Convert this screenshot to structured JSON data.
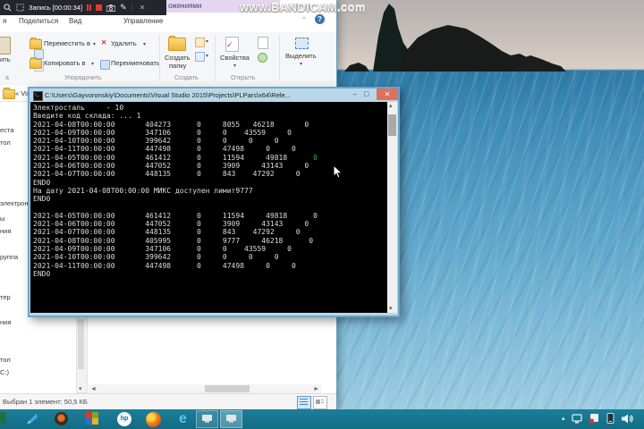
{
  "colors": {
    "taskbar_teal": "#15748e",
    "console_green_zero": "#3fae49",
    "console_close_button": "#e0705a",
    "contextual_tab_lavender": "#e4d5f0",
    "help_icon_blue": "#3674b5",
    "bandicam_red": "#e23b32"
  },
  "icons": {
    "dropdown": "▾",
    "close": "✕",
    "pencil": "✎",
    "scissors": "✂",
    "help": "?",
    "collapse": "⌃",
    "up": "▴",
    "down": "▾",
    "left": "◄",
    "right": "►",
    "tray_caret": "▴",
    "back": "«"
  },
  "bandicam_bar": {
    "record_label": "Запись [00:00:34]"
  },
  "watermark": {
    "text": "www.BANDICAM.com"
  },
  "explorer": {
    "contextual_header_fragment": "ожениями",
    "tabs": [
      {
        "label": "я"
      },
      {
        "label": "Поделиться"
      },
      {
        "label": "Вид"
      },
      {
        "label": "Управление"
      }
    ],
    "ribbon": {
      "paste_fragment": "ить",
      "clipboard_group_fragment": "а",
      "move_to": "Переместить в",
      "copy_to": "Копировать в",
      "delete": "Удалить",
      "rename": "Переименовать",
      "new_folder_line1": "Создать",
      "new_folder_line2": "папку",
      "properties": "Свойства",
      "select": "Выделить",
      "group_organize": "Упорядочить",
      "group_create": "Создать",
      "group_open": "Открыть"
    },
    "address_fragment": "« Vis",
    "nav_fragments": [
      {
        "text": "еста"
      },
      {
        "text": "тол"
      },
      {
        "text": "электрон"
      },
      {
        "text": "ы"
      },
      {
        "text": "ния"
      },
      {
        "text": "руппа"
      },
      {
        "text": "тер"
      },
      {
        "text": "ния"
      },
      {
        "text": "тол"
      },
      {
        "text": "C:)"
      }
    ],
    "status_text": "Выбран 1 элемент: 50,5 КБ"
  },
  "console": {
    "title": "C:\\Users\\Gayvoronskiy\\Documents\\Visual Studio 2015\\Projects\\PLPars\\x64\\Rele...",
    "green_line_index": 6,
    "lines": [
      "Электросталь     - 10",
      "Введите код склада: ... 1",
      "2021-04-08T00:00:00       404273      0     8055   46218       0",
      "2021-04-09T00:00:00       347106      0     0    43559     0",
      "2021-04-10T00:00:00       399642      0     0     0     0",
      "2021-04-11T00:00:00       447498      0     47498     0     0",
      "2021-04-05T00:00:00       461412      0     11594     49818      0",
      "2021-04-06T00:00:00       447052      0     3909     43143     0",
      "2021-04-07T00:00:00       448135      0     843    47292     0",
      "END0",
      "На дату 2021-04-08T00:00:00 МИКС доступен лимит9777",
      "END0",
      "",
      "2021-04-05T00:00:00       461412      0     11594     49818      0",
      "2021-04-06T00:00:00       447052      0     3909     43143     0",
      "2021-04-07T00:00:00       448135      0     843    47292     0",
      "2021-04-08T00:00:00       405995      0     9777     46218      0",
      "2021-04-09T00:00:00       347106      0     0    43559     0",
      "2021-04-10T00:00:00       399642      0     0     0     0",
      "2021-04-11T00:00:00       447498      0     47498     0     0",
      "END0"
    ]
  },
  "taskbar": {
    "hp_label": "hp",
    "ie_label": "e"
  }
}
